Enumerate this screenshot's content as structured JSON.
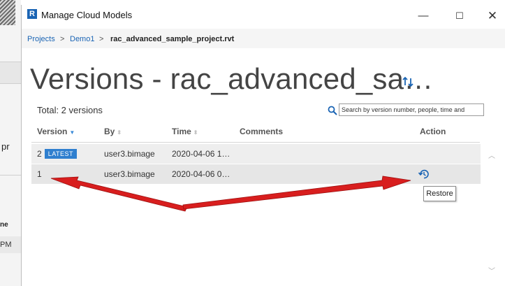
{
  "background_app": {
    "fragment_pr": "pr",
    "fragment_ne": "ne",
    "fragment_pm": "PM"
  },
  "window": {
    "title": "Manage Cloud Models",
    "app_icon_letter": "R",
    "minimize_glyph": "—",
    "maximize_glyph": "☐",
    "close_glyph": "✕"
  },
  "breadcrumb": {
    "items": [
      "Projects",
      "Demo1",
      "rac_advanced_sample_project.rvt"
    ],
    "separator": ">"
  },
  "page": {
    "title": "Versions - rac_advanced_sa…",
    "refresh_icon": "sync-icon"
  },
  "toolbar": {
    "total": "Total: 2 versions",
    "search_placeholder": "Search by version number, people, time and",
    "search_icon": "search-icon"
  },
  "table": {
    "columns": [
      "Version",
      "By",
      "Time",
      "Comments",
      "Action"
    ],
    "rows": [
      {
        "version": "2",
        "badge": "LATEST",
        "by": "user3.bimage",
        "time": "2020-04-06 1…",
        "comments": ""
      },
      {
        "version": "1",
        "badge": "",
        "by": "user3.bimage",
        "time": "2020-04-06 0…",
        "comments": "",
        "action_icon": "restore-icon"
      }
    ]
  },
  "tooltip": {
    "text": "Restore"
  },
  "colors": {
    "accent": "#1a64b4",
    "badge": "#2f7fcf",
    "annotation_arrow": "#d81e1e",
    "row_bg": "#eeeeee"
  }
}
